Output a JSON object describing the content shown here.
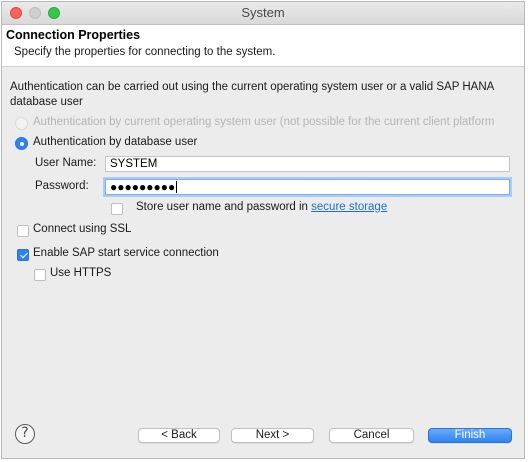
{
  "window": {
    "title": "System"
  },
  "banner": {
    "title": "Connection Properties",
    "description": "Specify the properties for connecting to the system."
  },
  "authentication": {
    "description": "Authentication can be carried out using the current operating system user or a valid SAP HANA database user",
    "options": [
      {
        "label": "Authentication by current operating system user (not possible for the current client platform",
        "selected": false,
        "enabled": false
      },
      {
        "label": "Authentication by database user",
        "selected": true,
        "enabled": true
      }
    ],
    "username_label": "User Name:",
    "username_value": "SYSTEM",
    "password_label": "Password:",
    "password_value": "●●●●●●●●●",
    "store_label_prefix": "Store user name and password in ",
    "store_link": "secure storage",
    "store_checked": false
  },
  "options": {
    "ssl_label": "Connect using SSL",
    "ssl_checked": false,
    "sap_start_label": "Enable SAP start service connection",
    "sap_start_checked": true,
    "https_label": "Use HTTPS",
    "https_checked": false
  },
  "footer": {
    "help": "?",
    "back": "< Back",
    "next": "Next >",
    "cancel": "Cancel",
    "finish": "Finish"
  },
  "colors": {
    "accent": "#2f82f0",
    "link": "#1e6fd0",
    "disabled_text": "#b5b5b5"
  },
  "icons": {
    "help": "help-icon"
  }
}
